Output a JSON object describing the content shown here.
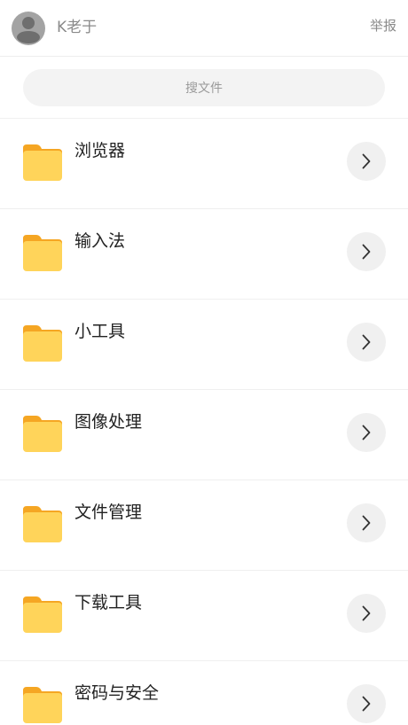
{
  "header": {
    "username": "K老于",
    "report_label": "举报",
    "avatar_icon": "user-avatar-icon"
  },
  "search": {
    "placeholder": "搜文件"
  },
  "folders": [
    {
      "label": "浏览器",
      "icon": "folder-icon",
      "action_icon": "chevron-right-icon"
    },
    {
      "label": "输入法",
      "icon": "folder-icon",
      "action_icon": "chevron-right-icon"
    },
    {
      "label": "小工具",
      "icon": "folder-icon",
      "action_icon": "chevron-right-icon"
    },
    {
      "label": "图像处理",
      "icon": "folder-icon",
      "action_icon": "chevron-right-icon"
    },
    {
      "label": "文件管理",
      "icon": "folder-icon",
      "action_icon": "chevron-right-icon"
    },
    {
      "label": "下载工具",
      "icon": "folder-icon",
      "action_icon": "chevron-right-icon"
    },
    {
      "label": "密码与安全",
      "icon": "folder-icon",
      "action_icon": "chevron-right-icon"
    }
  ],
  "colors": {
    "folder_back": "#f5a623",
    "folder_front": "#ffd45a",
    "text_primary": "#222222",
    "text_secondary": "#8a8a8a",
    "avatar_bg": "#a3a3a3"
  }
}
